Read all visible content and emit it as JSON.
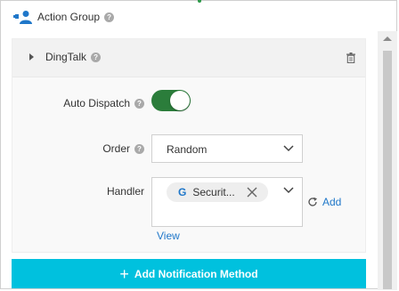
{
  "header": {
    "title": "Action Group",
    "icon": "people-icon",
    "help": "?"
  },
  "panel": {
    "title": "DingTalk",
    "help": "?"
  },
  "form": {
    "auto_dispatch": {
      "label": "Auto Dispatch",
      "help": "?",
      "enabled": true
    },
    "order": {
      "label": "Order",
      "help": "?",
      "value": "Random"
    },
    "handler": {
      "label": "Handler",
      "tag_icon": "G",
      "tag_text": "Securit...",
      "add_label": "Add",
      "view_label": "View"
    }
  },
  "actions": {
    "add_method_plus": "+",
    "add_method_label": "Add Notification Method"
  },
  "colors": {
    "accent": "#00c1de",
    "link": "#1f77c9",
    "toggle_on": "#2b7d3b"
  }
}
